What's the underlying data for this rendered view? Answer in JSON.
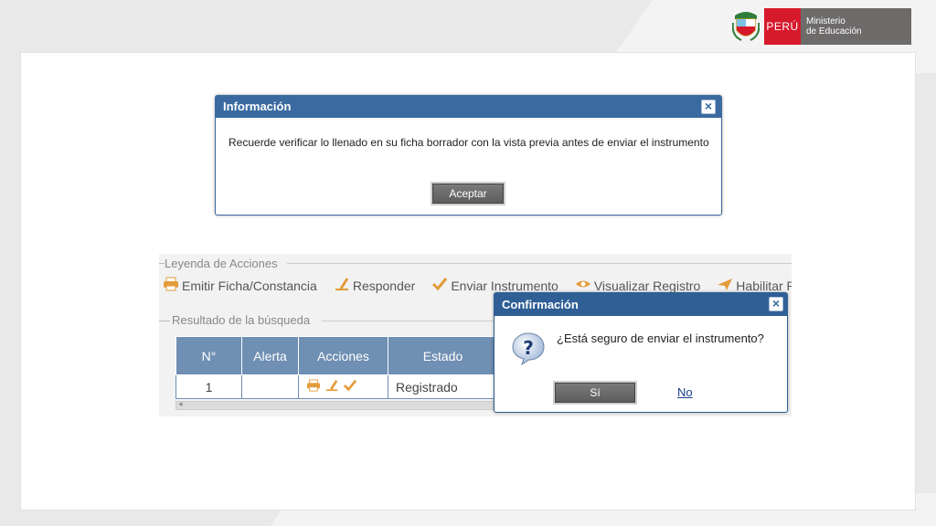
{
  "header": {
    "country": "PERÚ",
    "ministry_line1": "Ministerio",
    "ministry_line2": "de Educación",
    "colors": {
      "red": "#d7192c",
      "gray": "#6d6a6a"
    }
  },
  "info_dialog": {
    "title": "Información",
    "message": "Recuerde verificar lo llenado en su ficha borrador con la vista previa antes de enviar el instrumento",
    "accept_label": "Aceptar",
    "close_icon": "close-icon"
  },
  "panel": {
    "legend_title": "Leyenda de Acciones",
    "legend_items": [
      {
        "icon": "printer-icon",
        "label": "Emitir Ficha/Constancia"
      },
      {
        "icon": "pencil-icon",
        "label": "Responder"
      },
      {
        "icon": "check-icon",
        "label": "Enviar Instrumento"
      },
      {
        "icon": "eye-icon",
        "label": "Visualizar Registro"
      },
      {
        "icon": "send-icon",
        "label": "Habilitar Regi"
      }
    ],
    "results_title": "Resultado de la búsqueda",
    "table": {
      "columns": [
        "N°",
        "Alerta",
        "Acciones",
        "Estado"
      ],
      "rows": [
        {
          "n": "1",
          "alerta": "",
          "estado": "Registrado"
        }
      ]
    }
  },
  "confirm_dialog": {
    "title": "Confirmación",
    "message": "¿Está seguro de enviar el instrumento?",
    "yes_label": "Sí",
    "no_label": "No"
  }
}
